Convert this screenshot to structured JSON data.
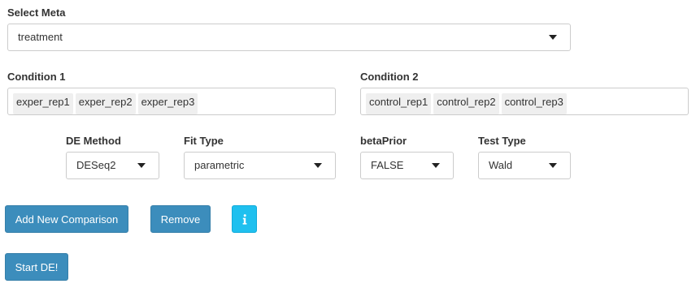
{
  "select_meta": {
    "label": "Select Meta",
    "value": "treatment"
  },
  "condition1": {
    "label": "Condition 1",
    "chips": [
      "exper_rep1",
      "exper_rep2",
      "exper_rep3"
    ]
  },
  "condition2": {
    "label": "Condition 2",
    "chips": [
      "control_rep1",
      "control_rep2",
      "control_rep3"
    ]
  },
  "de_method": {
    "label": "DE Method",
    "value": "DESeq2"
  },
  "fit_type": {
    "label": "Fit Type",
    "value": "parametric"
  },
  "beta_prior": {
    "label": "betaPrior",
    "value": "FALSE"
  },
  "test_type": {
    "label": "Test Type",
    "value": "Wald"
  },
  "buttons": {
    "add_comparison": "Add New Comparison",
    "remove": "Remove",
    "info_icon": "info-icon",
    "start_de": "Start DE!"
  },
  "colors": {
    "primary_button": "#3c8dbc",
    "info_button": "#1fc0ef"
  }
}
